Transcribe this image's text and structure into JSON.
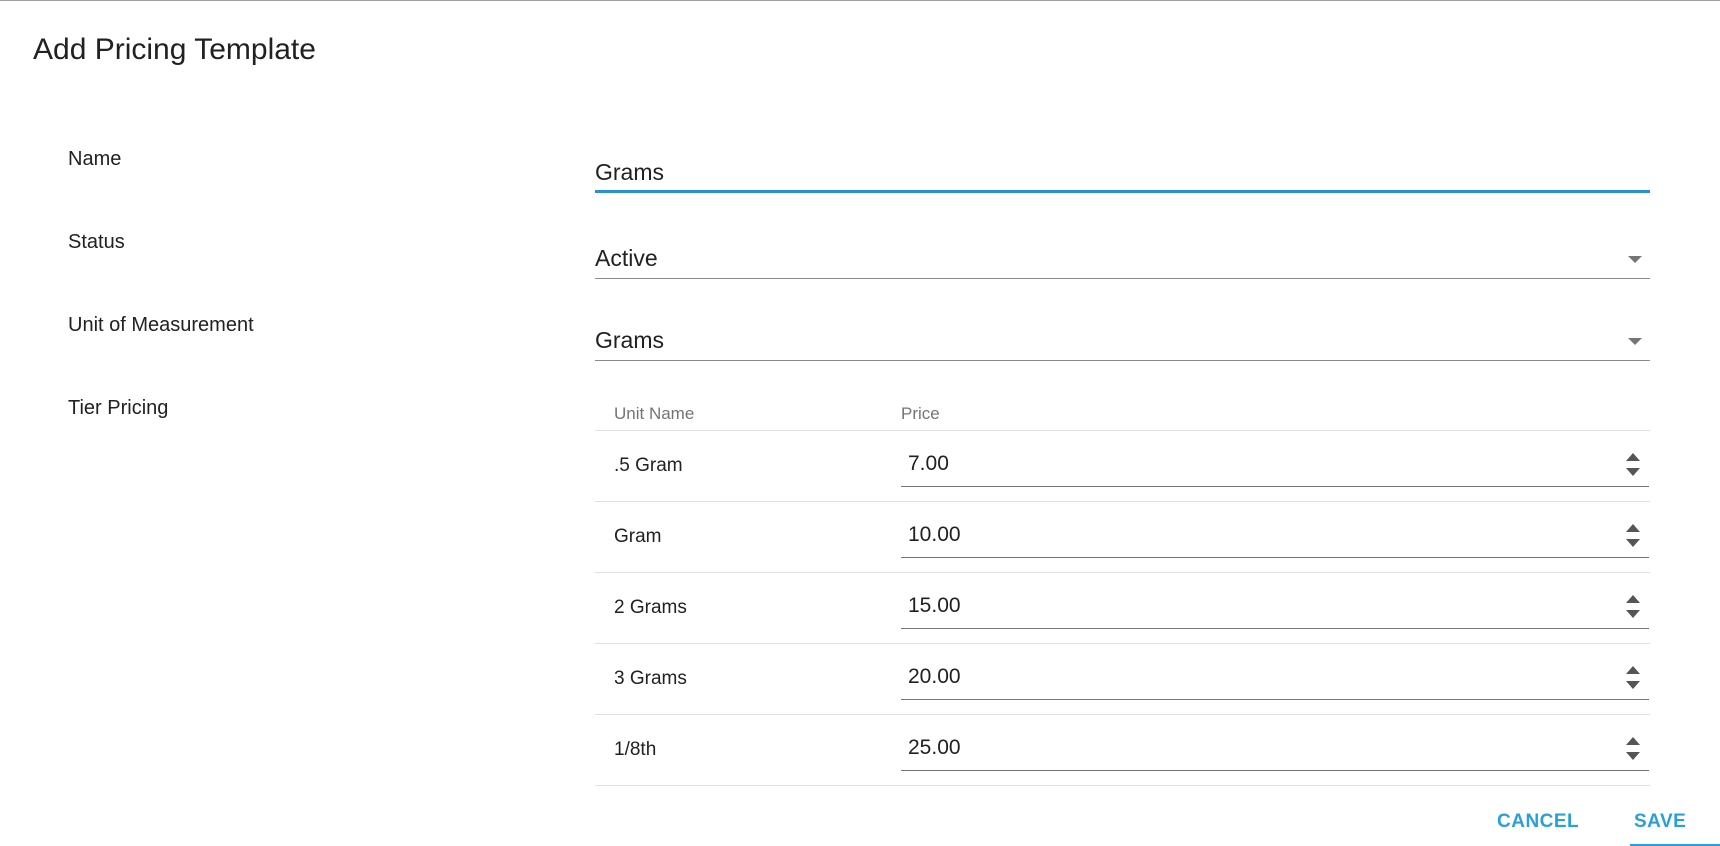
{
  "dialog": {
    "title": "Add Pricing Template"
  },
  "form": {
    "name": {
      "label": "Name",
      "value": "Grams"
    },
    "status": {
      "label": "Status",
      "value": "Active"
    },
    "unit_of_measurement": {
      "label": "Unit of Measurement",
      "value": "Grams"
    },
    "tier_pricing": {
      "label": "Tier Pricing",
      "columns": [
        "Unit Name",
        "Price"
      ],
      "rows": [
        {
          "unit": ".5 Gram",
          "price": "7.00"
        },
        {
          "unit": "Gram",
          "price": "10.00"
        },
        {
          "unit": "2 Grams",
          "price": "15.00"
        },
        {
          "unit": "3 Grams",
          "price": "20.00"
        },
        {
          "unit": "1/8th",
          "price": "25.00"
        }
      ]
    }
  },
  "actions": {
    "cancel_label": "CANCEL",
    "save_label": "SAVE"
  },
  "colors": {
    "accent": "#29a0dc",
    "focus_underline": "#2a8fd6"
  },
  "icons": {
    "select_caret": "chevron-down-icon",
    "number_spinner": "spinner-icon"
  }
}
